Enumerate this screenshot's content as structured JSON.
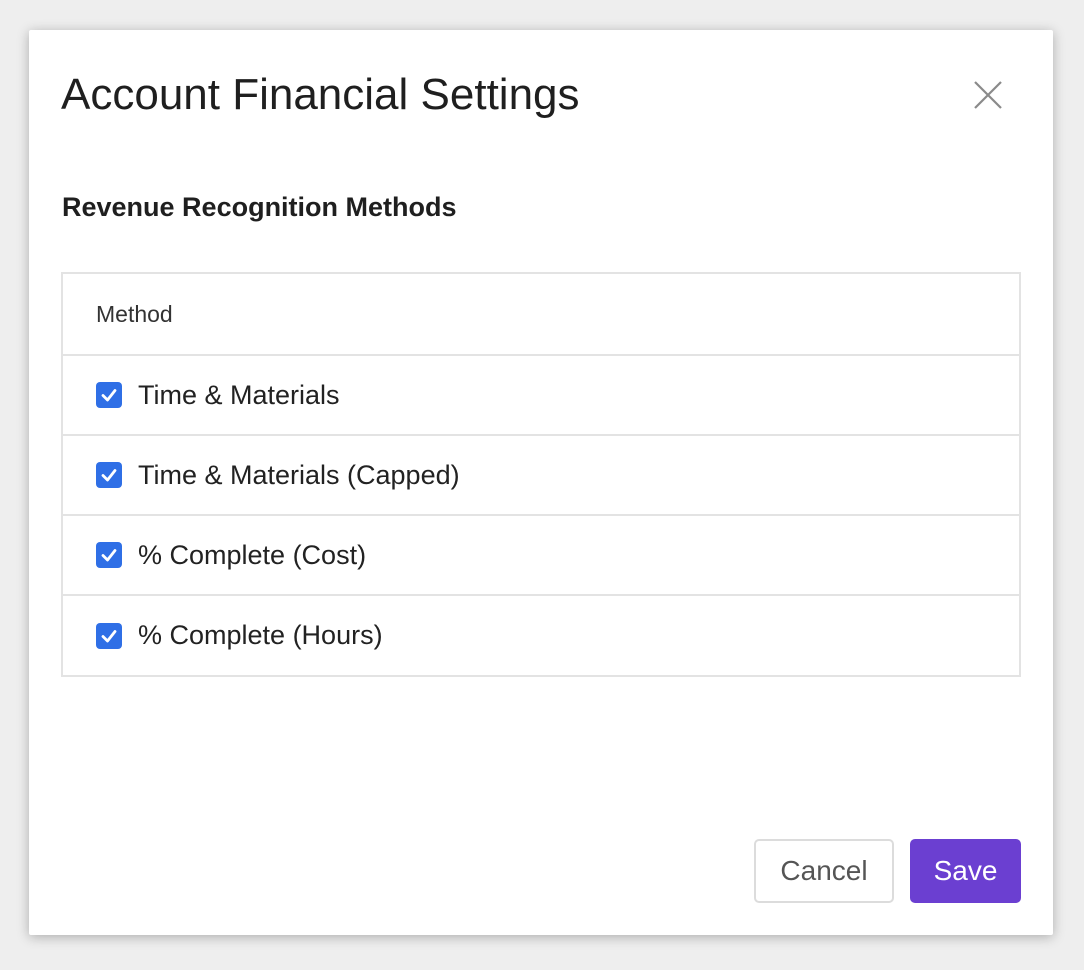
{
  "modal": {
    "title": "Account Financial Settings",
    "close_icon": "close-icon"
  },
  "section": {
    "title": "Revenue Recognition Methods"
  },
  "table": {
    "header": "Method",
    "rows": [
      {
        "label": "Time & Materials",
        "checked": true
      },
      {
        "label": "Time & Materials (Capped)",
        "checked": true
      },
      {
        "label": "% Complete (Cost)",
        "checked": true
      },
      {
        "label": "% Complete (Hours)",
        "checked": true
      }
    ]
  },
  "footer": {
    "cancel_label": "Cancel",
    "save_label": "Save"
  },
  "colors": {
    "checkbox": "#2f6fe6",
    "primary_button": "#6b3fd1"
  }
}
